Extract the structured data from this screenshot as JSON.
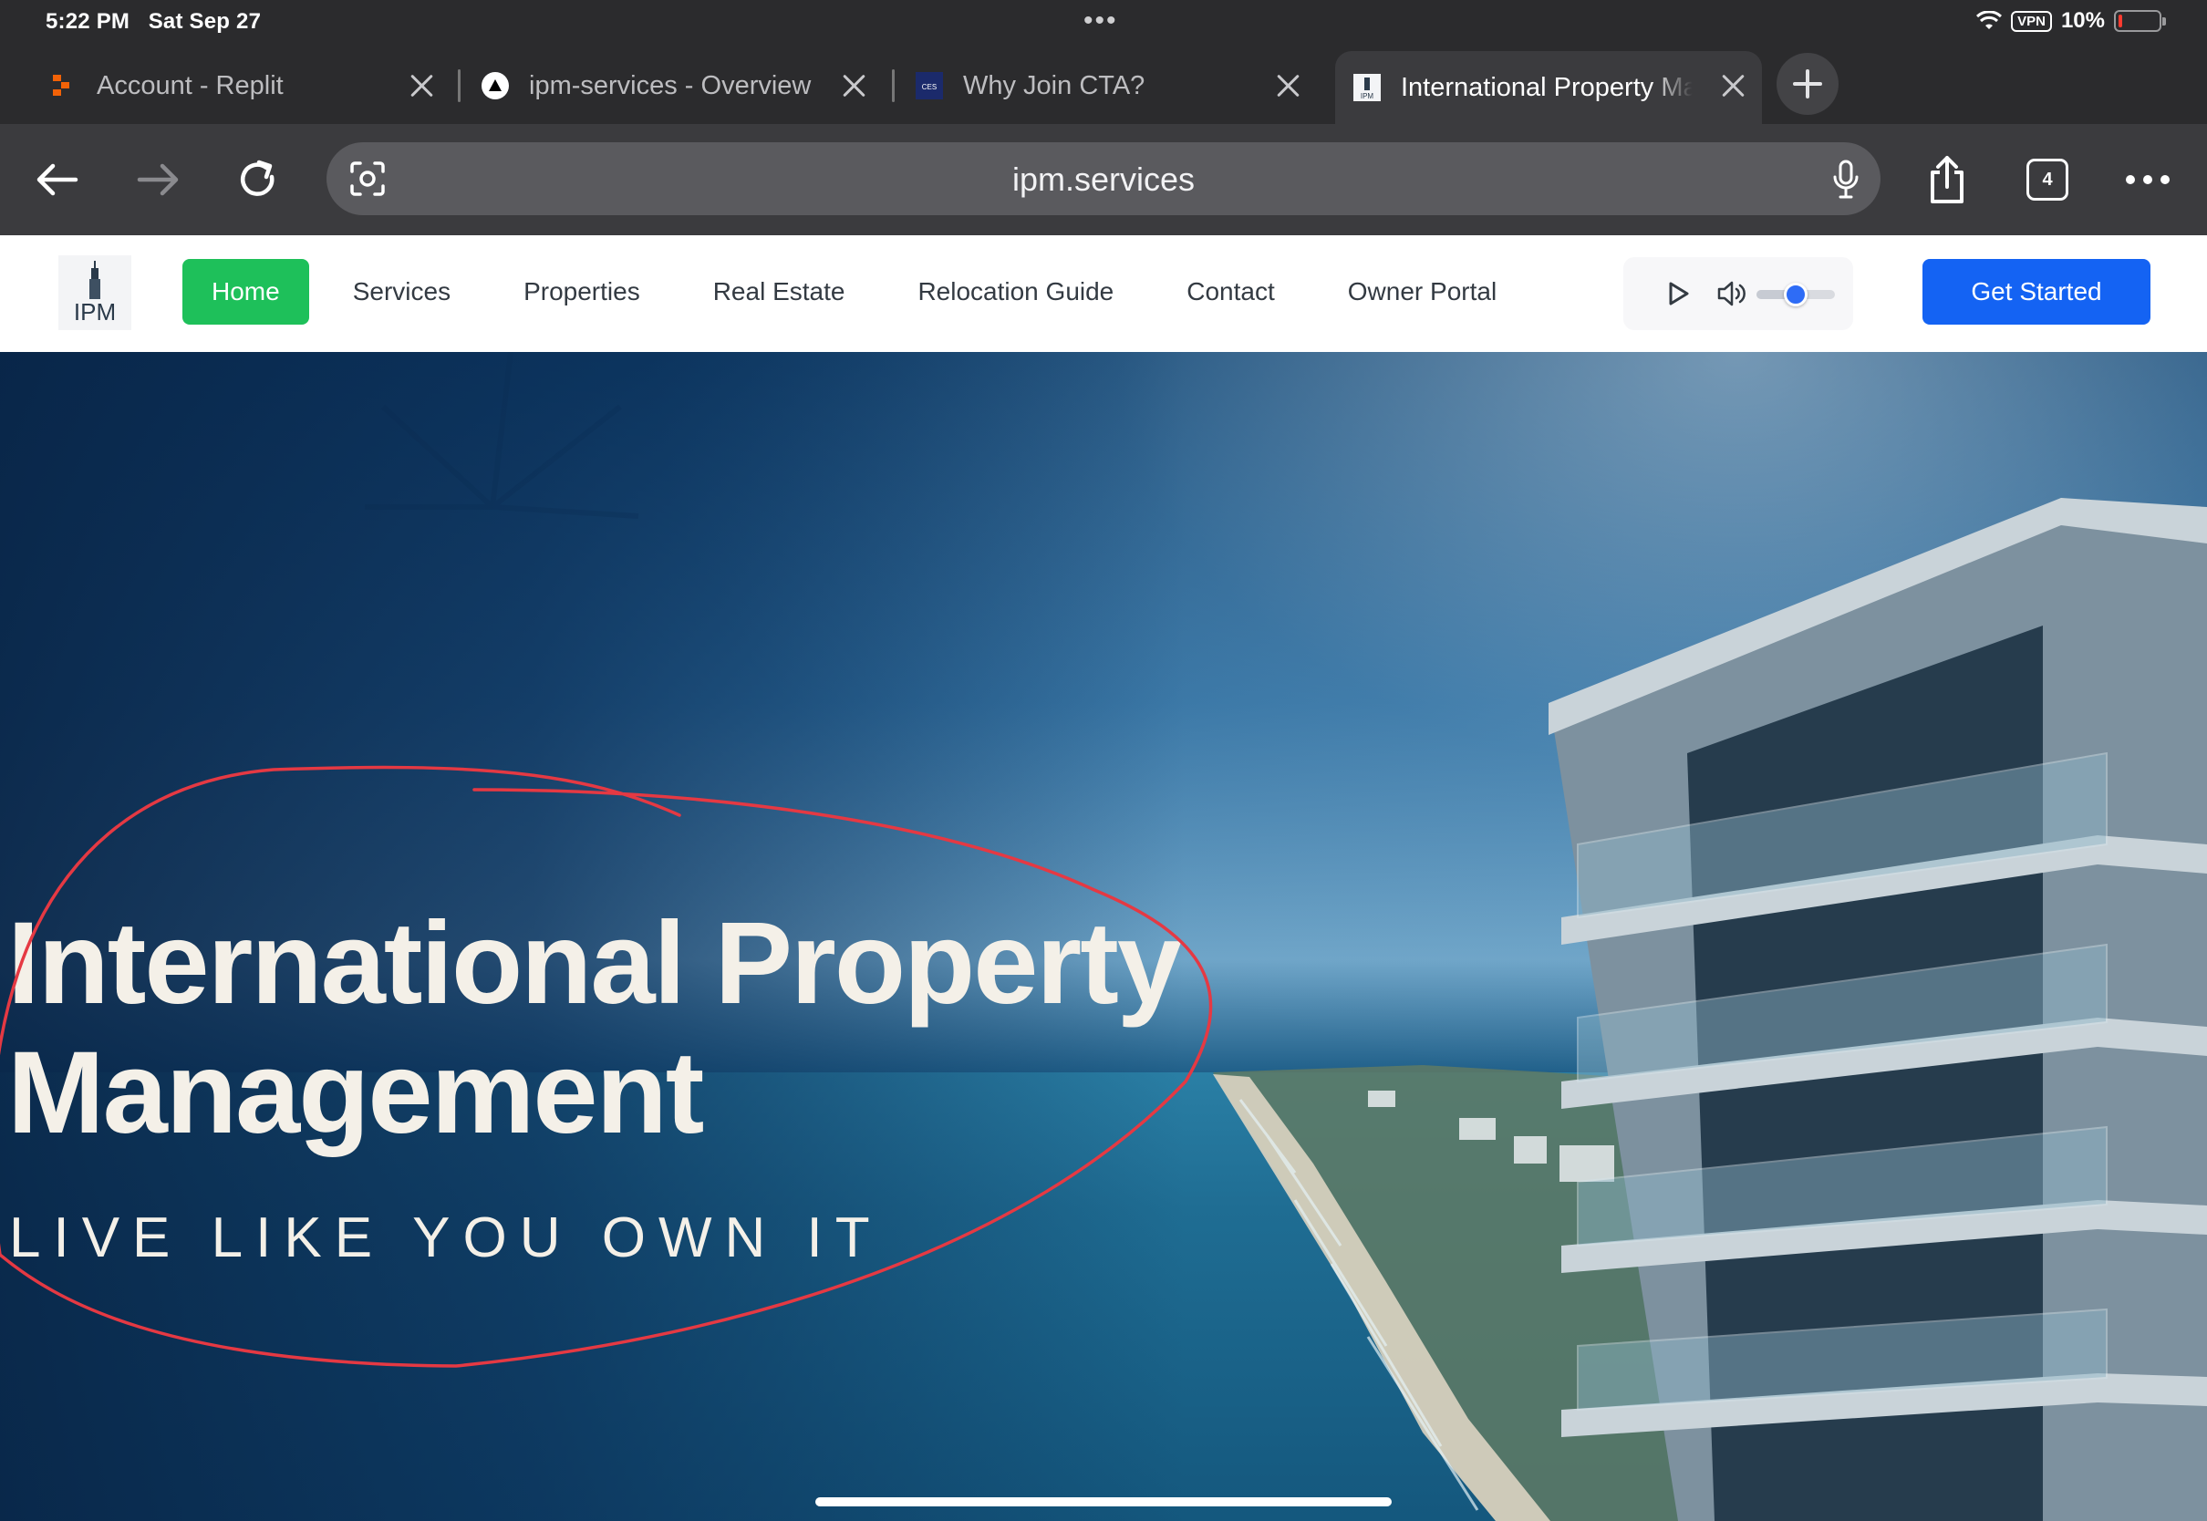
{
  "status_bar": {
    "time": "5:22 PM",
    "date": "Sat Sep 27",
    "vpn": "VPN",
    "battery": "10%",
    "battery_level": 0.1,
    "battery_color": "#ff3b30"
  },
  "tabs": [
    {
      "title": "Account - Replit",
      "icon": "replit-icon",
      "active": false
    },
    {
      "title": "ipm-services - Overview",
      "icon": "vercel-icon",
      "active": false
    },
    {
      "title": "Why Join CTA?",
      "icon": "ces-icon",
      "active": false
    },
    {
      "title": "International Property Management",
      "icon": "ipm-icon",
      "active": true
    }
  ],
  "toolbar": {
    "url": "ipm.services",
    "tab_count": "4"
  },
  "site": {
    "logo_text": "IPM",
    "nav": [
      "Home",
      "Services",
      "Properties",
      "Real Estate",
      "Relocation Guide",
      "Contact",
      "Owner Portal"
    ],
    "active_nav": "Home",
    "cta": "Get Started",
    "volume_level": 0.5,
    "colors": {
      "active_nav": "#1ec05a",
      "cta": "#1463f3",
      "slider_thumb": "#2e6cf6"
    }
  },
  "hero": {
    "title_line1": "International Property",
    "title_line2": "Management",
    "tagline": "LIVE LIKE YOU OWN IT",
    "annotation_color": "#e53943"
  }
}
